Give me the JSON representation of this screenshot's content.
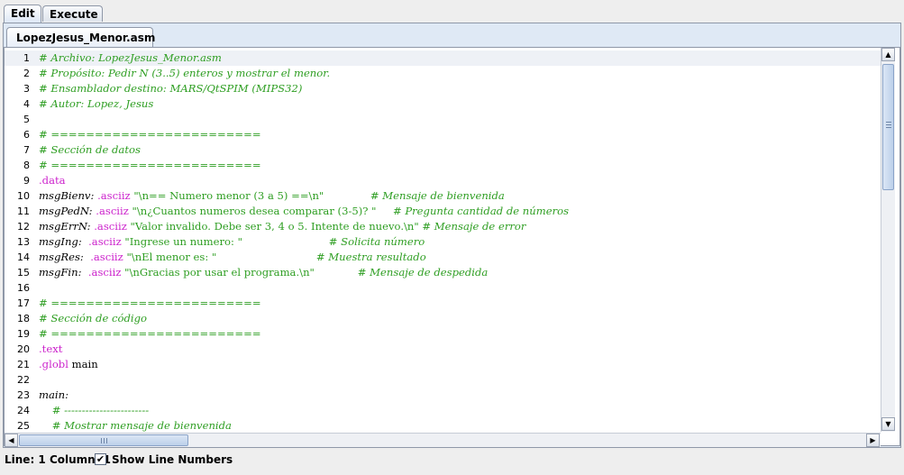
{
  "outer_tabs": [
    {
      "label": "Edit",
      "active": true
    },
    {
      "label": "Execute",
      "active": false
    }
  ],
  "file_tab": {
    "label": "LopezJesus_Menor.asm"
  },
  "editor": {
    "current_line": 1,
    "lines": [
      [
        {
          "t": "# Archivo: LopezJesus_Menor.asm",
          "c": "com"
        }
      ],
      [
        {
          "t": "# Propósito: Pedir N (3..5) enteros y mostrar el menor.",
          "c": "com"
        }
      ],
      [
        {
          "t": "# Ensamblador destino: MARS/QtSPIM (MIPS32)",
          "c": "com"
        }
      ],
      [
        {
          "t": "# Autor: Lopez, Jesus",
          "c": "com"
        }
      ],
      [],
      [
        {
          "t": "# ========================",
          "c": "com"
        }
      ],
      [
        {
          "t": "# Sección de datos",
          "c": "com"
        }
      ],
      [
        {
          "t": "# ========================",
          "c": "com"
        }
      ],
      [
        {
          "t": ".data",
          "c": "dir"
        }
      ],
      [
        {
          "t": "msgBienv:",
          "c": "lbl"
        },
        {
          "t": " ",
          "c": "txt"
        },
        {
          "t": ".asciiz",
          "c": "dir"
        },
        {
          "t": " \"\\n== Numero menor (3 a 5) ==\\n\"              ",
          "c": "str"
        },
        {
          "t": "# Mensaje de bienvenida",
          "c": "com"
        }
      ],
      [
        {
          "t": "msgPedN:",
          "c": "lbl"
        },
        {
          "t": " ",
          "c": "txt"
        },
        {
          "t": ".asciiz",
          "c": "dir"
        },
        {
          "t": " \"\\n¿Cuantos numeros desea comparar (3-5)? \"     ",
          "c": "str"
        },
        {
          "t": "# Pregunta cantidad de números",
          "c": "com"
        }
      ],
      [
        {
          "t": "msgErrN:",
          "c": "lbl"
        },
        {
          "t": " ",
          "c": "txt"
        },
        {
          "t": ".asciiz",
          "c": "dir"
        },
        {
          "t": " \"Valor invalido. Debe ser 3, 4 o 5. Intente de nuevo.\\n\" ",
          "c": "str"
        },
        {
          "t": "# Mensaje de error",
          "c": "com"
        }
      ],
      [
        {
          "t": "msgIng:",
          "c": "lbl"
        },
        {
          "t": "  ",
          "c": "txt"
        },
        {
          "t": ".asciiz",
          "c": "dir"
        },
        {
          "t": " \"Ingrese un numero: \"                          ",
          "c": "str"
        },
        {
          "t": "# Solicita número",
          "c": "com"
        }
      ],
      [
        {
          "t": "msgRes:",
          "c": "lbl"
        },
        {
          "t": "  ",
          "c": "txt"
        },
        {
          "t": ".asciiz",
          "c": "dir"
        },
        {
          "t": " \"\\nEl menor es: \"                              ",
          "c": "str"
        },
        {
          "t": "# Muestra resultado",
          "c": "com"
        }
      ],
      [
        {
          "t": "msgFin:",
          "c": "lbl"
        },
        {
          "t": "  ",
          "c": "txt"
        },
        {
          "t": ".asciiz",
          "c": "dir"
        },
        {
          "t": " \"\\nGracias por usar el programa.\\n\"             ",
          "c": "str"
        },
        {
          "t": "# Mensaje de despedida",
          "c": "com"
        }
      ],
      [],
      [
        {
          "t": "# ========================",
          "c": "com"
        }
      ],
      [
        {
          "t": "# Sección de código",
          "c": "com"
        }
      ],
      [
        {
          "t": "# ========================",
          "c": "com"
        }
      ],
      [
        {
          "t": ".text",
          "c": "dir"
        }
      ],
      [
        {
          "t": ".globl",
          "c": "dir"
        },
        {
          "t": " main",
          "c": "txt"
        }
      ],
      [],
      [
        {
          "t": "main:",
          "c": "lbl"
        }
      ],
      [
        {
          "t": "    # ------------------------",
          "c": "com"
        }
      ],
      [
        {
          "t": "    # Mostrar mensaje de bienvenida",
          "c": "com"
        }
      ]
    ]
  },
  "status": {
    "text": "Line: 1 Column: 1"
  },
  "show_line_numbers": {
    "label": "Show Line Numbers",
    "checked": true,
    "check_glyph": "✔"
  },
  "icons": {
    "scroll_up": "▲",
    "scroll_down": "▼",
    "scroll_left": "◀",
    "scroll_right": "▶"
  }
}
